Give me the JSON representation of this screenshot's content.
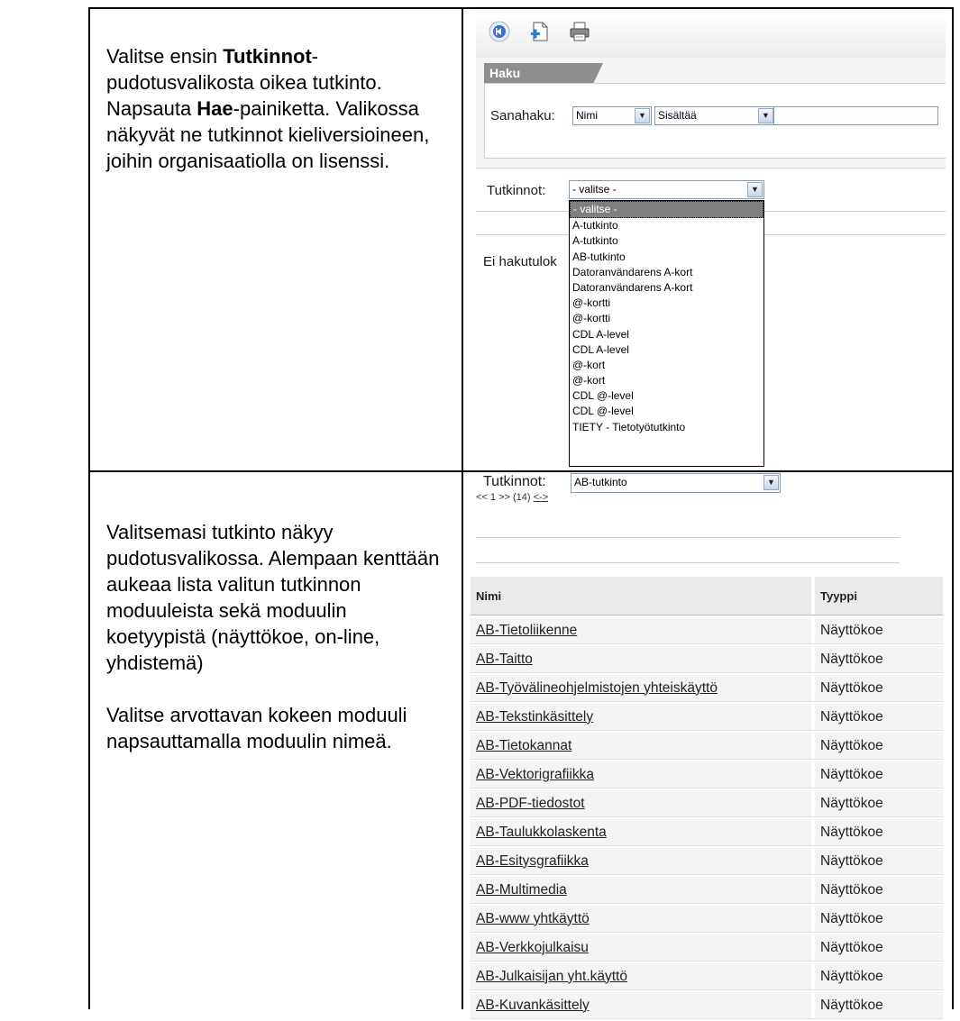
{
  "instructions": {
    "top": {
      "p1_prefix": "Valitse ensin ",
      "p1_bold": "Tutkinnot",
      "p1_suffix": "-pudotusvalikosta oikea tutkinto. Napsauta ",
      "p1_bold2": "Hae",
      "p1_suffix2": "-painiketta. Valikossa näkyvät ne tutkinnot kieliversioineen, joihin organisaatiolla on lisenssi."
    },
    "bottom": {
      "p1": "Valitsemasi tutkinto näkyy pudotusvalikossa. Alempaan kenttään aukeaa lista valitun tutkinnon moduuleista sekä moduulin koetyypistä (näyttökoe, on-line, yhdistemä)",
      "p2": "Valitse arvottavan kokeen moduuli napsauttamalla moduulin nimeä."
    }
  },
  "top_panel": {
    "toolbar_icons": [
      "back-icon",
      "add-document-icon",
      "print-icon"
    ],
    "haku_title": "Haku",
    "sanahaku_label": "Sanahaku:",
    "field_select": "Nimi",
    "mode_select": "Sisältää",
    "search_value": "",
    "tutkinnot_label": "Tutkinnot:",
    "tutkinnot_value": "- valitse -",
    "no_results": "Ei hakutulok",
    "dropdown_options": [
      "- valitse -",
      "A-tutkinto",
      "A-tutkinto",
      "AB-tutkinto",
      "Datoranvändarens A-kort",
      "Datoranvändarens A-kort",
      "@-kortti",
      "@-kortti",
      "CDL A-level",
      "CDL A-level",
      "@-kort",
      "@-kort",
      "CDL @-level",
      "CDL @-level",
      "TIETY - Tietotyötutkinto"
    ]
  },
  "bottom_panel": {
    "tutkinnot_label": "Tutkinnot:",
    "tutkinnot_value": "AB-tutkinto",
    "pager_prefix": "<< 1 >> (14) ",
    "pager_link": "<->",
    "table": {
      "headers": [
        "Nimi",
        "Tyyppi"
      ],
      "rows": [
        [
          "AB-Tietoliikenne",
          "Näyttökoe"
        ],
        [
          "AB-Taitto",
          "Näyttökoe"
        ],
        [
          "AB-Työvälineohjelmistojen yhteiskäyttö",
          "Näyttökoe"
        ],
        [
          "AB-Tekstinkäsittely",
          "Näyttökoe"
        ],
        [
          "AB-Tietokannat",
          "Näyttökoe"
        ],
        [
          "AB-Vektorigrafiikka",
          "Näyttökoe"
        ],
        [
          "AB-PDF-tiedostot",
          "Näyttökoe"
        ],
        [
          "AB-Taulukkolaskenta",
          "Näyttökoe"
        ],
        [
          "AB-Esitysgrafiikka",
          "Näyttökoe"
        ],
        [
          "AB-Multimedia",
          "Näyttökoe"
        ],
        [
          "AB-www yhtkäyttö",
          "Näyttökoe"
        ],
        [
          "AB-Verkkojulkaisu",
          "Näyttökoe"
        ],
        [
          "AB-Julkaisijan yht.käyttö",
          "Näyttökoe"
        ],
        [
          "AB-Kuvankäsittely",
          "Näyttökoe"
        ]
      ]
    }
  }
}
